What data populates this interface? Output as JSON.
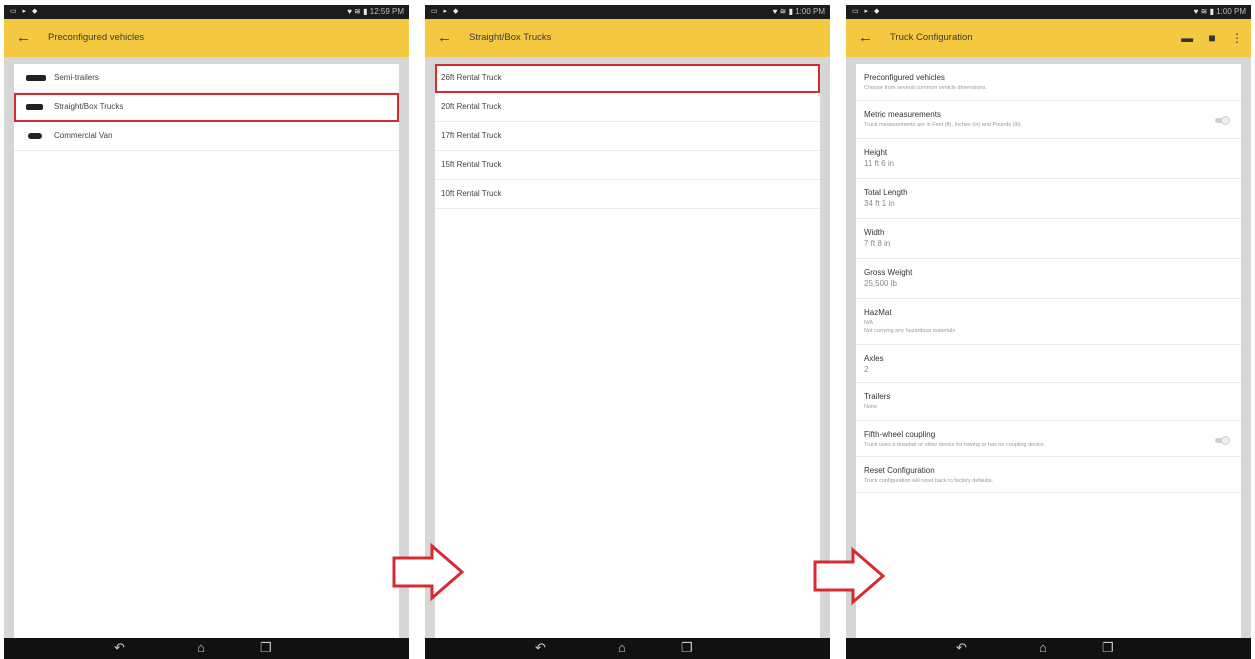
{
  "status_bars": [
    {
      "left_icons": "▭ ▸ ◆",
      "right_icons": "♥ ≋",
      "battery": "▮",
      "time": "12:59 PM"
    },
    {
      "left_icons": "▭ ▸ ◆",
      "right_icons": "♥ ≋",
      "battery": "▮",
      "time": "1:00 PM"
    },
    {
      "left_icons": "▭ ▸ ◆",
      "right_icons": "♥ ≋",
      "battery": "▮",
      "time": "1:00 PM"
    }
  ],
  "back_glyph": "←",
  "nav_glyphs": {
    "back": "↶",
    "home": "⌂",
    "recent": "❐"
  },
  "screen1": {
    "title": "Preconfigured vehicles",
    "items": [
      {
        "label": "Semi-trailers",
        "icon": "semi-trailer-icon"
      },
      {
        "label": "Straight/Box Trucks",
        "icon": "box-truck-icon"
      },
      {
        "label": "Commercial Van",
        "icon": "van-icon"
      }
    ]
  },
  "screen2": {
    "title": "Straight/Box Trucks",
    "items": [
      {
        "label": "26ft Rental Truck"
      },
      {
        "label": "20ft Rental Truck"
      },
      {
        "label": "17ft Rental Truck"
      },
      {
        "label": "15ft Rental Truck"
      },
      {
        "label": "10ft Rental Truck"
      }
    ]
  },
  "screen3": {
    "title": "Truck Configuration",
    "action_glyphs": {
      "folder": "▬",
      "save": "■",
      "more": "⋮"
    },
    "rows": [
      {
        "title": "Preconfigured vehicles",
        "sub": "Choose from several common vehicle dimensions."
      },
      {
        "title": "Metric measurements",
        "sub": "Truck measurements are in Feet (ft), Inches (in) and Pounds (lb)."
      },
      {
        "title": "Height",
        "value": "11 ft 6 in"
      },
      {
        "title": "Total Length",
        "value": "34 ft 1 in"
      },
      {
        "title": "Width",
        "value": "7 ft 8 in"
      },
      {
        "title": "Gross Weight",
        "value": "25,500 lb"
      },
      {
        "title": "HazMat",
        "sub": "N/A",
        "sub2": "Not carrying any hazardous materials"
      },
      {
        "title": "Axles",
        "value": "2"
      },
      {
        "title": "Trailers",
        "sub": "None"
      },
      {
        "title": "Fifth-wheel coupling",
        "sub": "Truck uses a drawbar or other device for towing or has no coupling device."
      },
      {
        "title": "Reset Configuration",
        "sub": "Truck configuration will reset back to factory defaults."
      }
    ]
  },
  "colors": {
    "appbar": "#f5c842",
    "highlight": "#d62b33",
    "navbar": "#111111"
  }
}
